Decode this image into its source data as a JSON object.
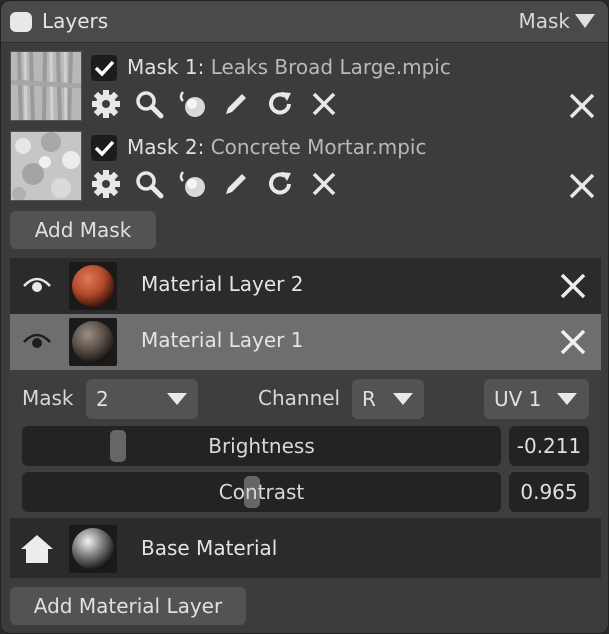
{
  "header": {
    "title": "Layers",
    "mode": "Mask"
  },
  "masks": [
    {
      "index_label": "Mask 1:",
      "file": "Leaks Broad Large.mpic",
      "checked": true
    },
    {
      "index_label": "Mask 2:",
      "file": "Concrete Mortar.mpic",
      "checked": true
    }
  ],
  "mask_tools": [
    "gear-icon",
    "search-icon",
    "paint-bucket-icon",
    "pencil-icon",
    "refresh-icon",
    "close-icon"
  ],
  "add_mask_label": "Add Mask",
  "layers": [
    {
      "name": "Material Layer 2",
      "selected": false,
      "ball_color": "#b4492c"
    },
    {
      "name": "Material Layer 1",
      "selected": true,
      "ball_color": "#5a4f48"
    }
  ],
  "properties": {
    "mask_label": "Mask",
    "mask_value": "2",
    "channel_label": "Channel",
    "channel_value": "R",
    "uv_value": "UV 1",
    "brightness_label": "Brightness",
    "brightness_value": "-0.211",
    "contrast_label": "Contrast",
    "contrast_value": "0.965"
  },
  "base_material": {
    "name": "Base Material"
  },
  "add_layer_label": "Add Material Layer",
  "colors": {
    "panel": "#3c3c3c",
    "header": "#4a4a4a",
    "selected_row": "#6e6e6e",
    "button": "#535353"
  }
}
